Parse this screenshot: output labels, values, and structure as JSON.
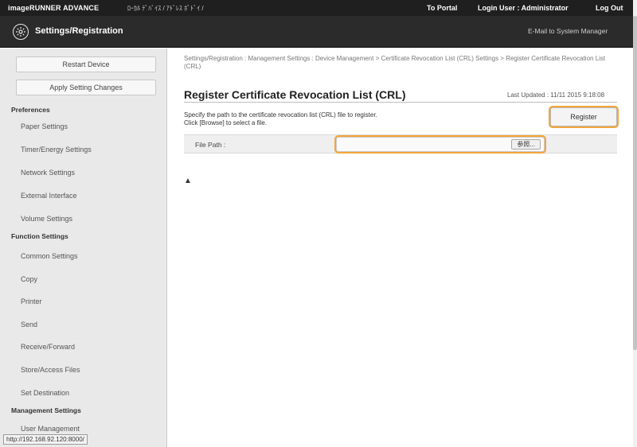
{
  "topbar": {
    "brand": "imageRUNNER ADVANCE",
    "device_name": "ﾛｰｶﾙ ﾃﾞﾊﾞｲｽ / ｱﾄﾞﾚｽ ﾎﾞﾄﾞｲ /",
    "to_portal": "To Portal",
    "login_user": "Login User : Administrator",
    "log_out": "Log Out"
  },
  "header": {
    "title": "Settings/Registration",
    "email_link": "E-Mail to System Manager"
  },
  "sidebar": {
    "restart_button": "Restart Device",
    "apply_button": "Apply Setting Changes",
    "sections": [
      {
        "heading": "Preferences",
        "items": [
          "Paper Settings",
          "Timer/Energy Settings",
          "Network Settings",
          "External Interface",
          "Volume Settings"
        ]
      },
      {
        "heading": "Function Settings",
        "items": [
          "Common Settings",
          "Copy",
          "Printer",
          "Send",
          "Receive/Forward",
          "Store/Access Files",
          "Set Destination"
        ]
      },
      {
        "heading": "Management Settings",
        "items": [
          "User Management"
        ]
      }
    ]
  },
  "main": {
    "breadcrumb": "Settings/Registration : Management Settings : Device Management > Certificate Revocation List (CRL) Settings > Register Certificate Revocation List (CRL)",
    "title": "Register Certificate Revocation List (CRL)",
    "last_updated": "Last Updated : 11/11 2015 9:18:08",
    "description_line1": "Specify the path to the certificate revocation list (CRL) file to register.",
    "description_line2": "Click [Browse] to select a file.",
    "register_button": "Register",
    "file_path_label": "File Path :",
    "file_path_value": "",
    "browse_button": "参照...",
    "to_top": "▲"
  },
  "status_url": "http://192.168.92.120:8000/",
  "colors": {
    "topbar_bg": "#1f1f1f",
    "header_bg": "#2b2b2b",
    "highlight_orange": "#f3a63a",
    "sidebar_bg": "#e9e9e9"
  }
}
